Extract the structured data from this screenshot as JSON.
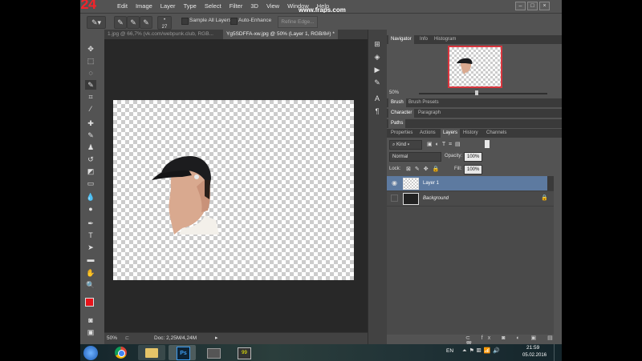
{
  "overlay": {
    "fraps_counter": "24",
    "fraps_url": "www.fraps.com"
  },
  "menu": [
    "Edit",
    "Image",
    "Layer",
    "Type",
    "Select",
    "Filter",
    "3D",
    "View",
    "Window",
    "Help"
  ],
  "window_controls": [
    "–",
    "□",
    "×"
  ],
  "options_bar": {
    "brush_size": "27",
    "sample_all_layers": "Sample All Layers",
    "auto_enhance": "Auto-Enhance",
    "refine_edge": "Refine Edge..."
  },
  "document_tabs": [
    {
      "label": "1.jpg @ 66,7% (vk.com/webpunk.club, RGB...",
      "active": false
    },
    {
      "label": "Yg5SDFFA-xw.jpg @ 50% (Layer 1, RGB/8#) *",
      "active": true
    }
  ],
  "status_bar": {
    "zoom": "50%",
    "doc": "Doc: 2,25M/4,24M"
  },
  "panels": {
    "navigator_tabs": [
      "Navigator",
      "Info",
      "Histogram"
    ],
    "nav_zoom": "50%",
    "brush_tabs": [
      "Brush",
      "Brush Presets"
    ],
    "char_tabs": [
      "Character",
      "Paragraph"
    ],
    "paths_tab": "Paths",
    "layers_tabs": [
      "Properties",
      "Actions",
      "Layers",
      "History",
      "Channels"
    ],
    "kind_label": "Kind",
    "blend_mode": "Normal",
    "opacity_label": "Opacity:",
    "opacity_value": "100%",
    "lock_label": "Lock:",
    "fill_label": "Fill:",
    "fill_value": "100%",
    "layers": [
      {
        "name": "Layer 1",
        "visible": true,
        "selected": true
      },
      {
        "name": "Background",
        "visible": false,
        "selected": false,
        "locked": true
      }
    ]
  },
  "taskbar": {
    "lang": "EN",
    "time": "21:59",
    "date": "05.02.2016"
  },
  "colors": {
    "foreground": "#e8141b",
    "background": "#ffffff",
    "selected_layer": "#5d7aa0"
  }
}
